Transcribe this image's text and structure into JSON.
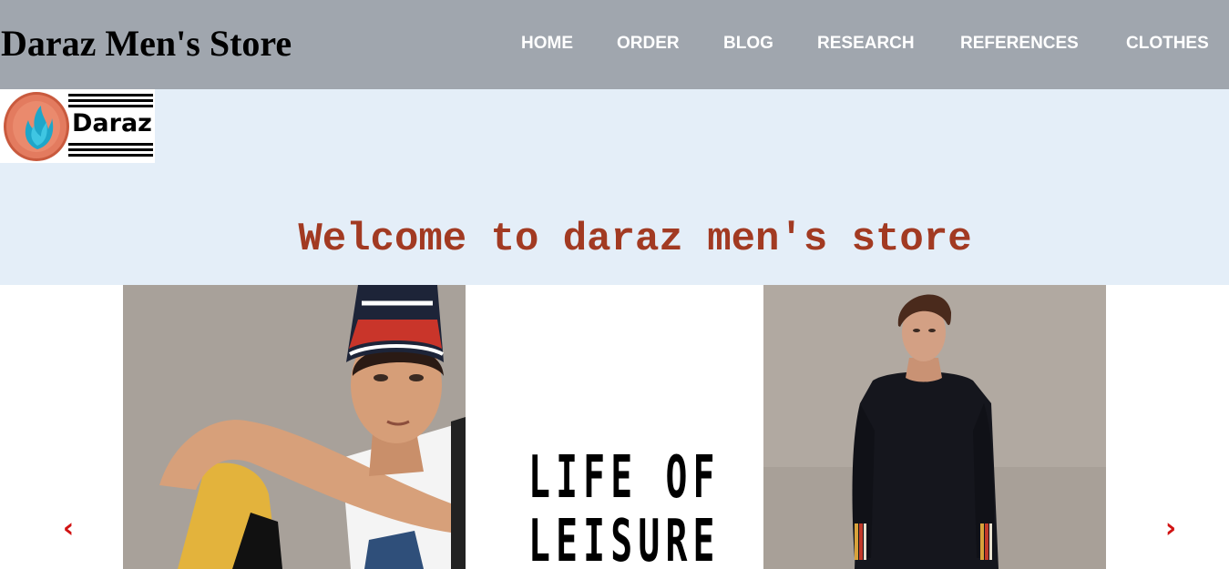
{
  "header": {
    "brand": "Daraz Men's Store",
    "nav": [
      "HOME",
      "ORDER",
      "BLOG",
      "RESEARCH",
      "REFERENCES",
      "CLOTHES"
    ]
  },
  "logo": {
    "text": "Daraz"
  },
  "banner": {
    "welcome": "Welcome to daraz men's store"
  },
  "slider": {
    "tagline_line1": "LIFE OF",
    "tagline_line2": "LEISURE",
    "prev_glyph": "‹",
    "next_glyph": "›"
  },
  "colors": {
    "header_bg": "#a0a6ae",
    "banner_bg": "#e4eef8",
    "welcome_text": "#a23a22",
    "arrow": "#d11313"
  }
}
